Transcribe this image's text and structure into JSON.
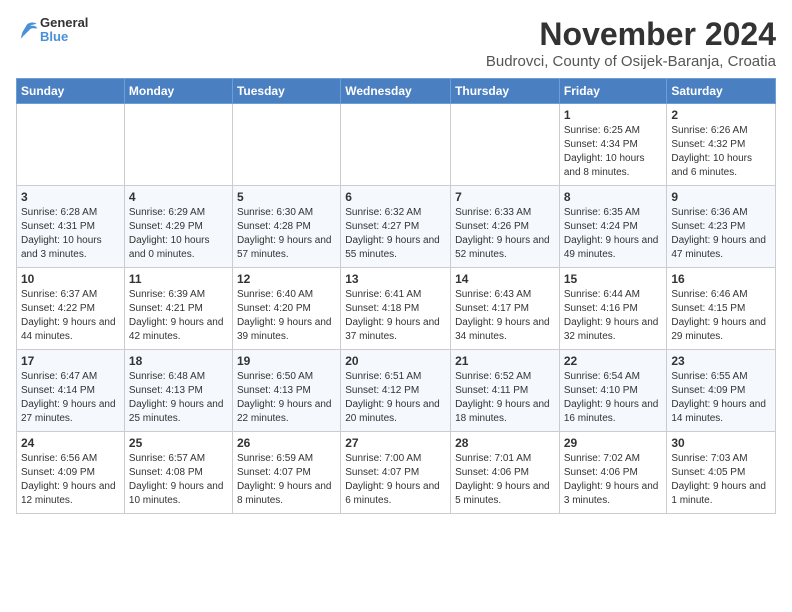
{
  "header": {
    "logo_general": "General",
    "logo_blue": "Blue",
    "month_title": "November 2024",
    "location": "Budrovci, County of Osijek-Baranja, Croatia"
  },
  "weekdays": [
    "Sunday",
    "Monday",
    "Tuesday",
    "Wednesday",
    "Thursday",
    "Friday",
    "Saturday"
  ],
  "weeks": [
    [
      {
        "day": "",
        "info": ""
      },
      {
        "day": "",
        "info": ""
      },
      {
        "day": "",
        "info": ""
      },
      {
        "day": "",
        "info": ""
      },
      {
        "day": "",
        "info": ""
      },
      {
        "day": "1",
        "info": "Sunrise: 6:25 AM\nSunset: 4:34 PM\nDaylight: 10 hours and 8 minutes."
      },
      {
        "day": "2",
        "info": "Sunrise: 6:26 AM\nSunset: 4:32 PM\nDaylight: 10 hours and 6 minutes."
      }
    ],
    [
      {
        "day": "3",
        "info": "Sunrise: 6:28 AM\nSunset: 4:31 PM\nDaylight: 10 hours and 3 minutes."
      },
      {
        "day": "4",
        "info": "Sunrise: 6:29 AM\nSunset: 4:29 PM\nDaylight: 10 hours and 0 minutes."
      },
      {
        "day": "5",
        "info": "Sunrise: 6:30 AM\nSunset: 4:28 PM\nDaylight: 9 hours and 57 minutes."
      },
      {
        "day": "6",
        "info": "Sunrise: 6:32 AM\nSunset: 4:27 PM\nDaylight: 9 hours and 55 minutes."
      },
      {
        "day": "7",
        "info": "Sunrise: 6:33 AM\nSunset: 4:26 PM\nDaylight: 9 hours and 52 minutes."
      },
      {
        "day": "8",
        "info": "Sunrise: 6:35 AM\nSunset: 4:24 PM\nDaylight: 9 hours and 49 minutes."
      },
      {
        "day": "9",
        "info": "Sunrise: 6:36 AM\nSunset: 4:23 PM\nDaylight: 9 hours and 47 minutes."
      }
    ],
    [
      {
        "day": "10",
        "info": "Sunrise: 6:37 AM\nSunset: 4:22 PM\nDaylight: 9 hours and 44 minutes."
      },
      {
        "day": "11",
        "info": "Sunrise: 6:39 AM\nSunset: 4:21 PM\nDaylight: 9 hours and 42 minutes."
      },
      {
        "day": "12",
        "info": "Sunrise: 6:40 AM\nSunset: 4:20 PM\nDaylight: 9 hours and 39 minutes."
      },
      {
        "day": "13",
        "info": "Sunrise: 6:41 AM\nSunset: 4:18 PM\nDaylight: 9 hours and 37 minutes."
      },
      {
        "day": "14",
        "info": "Sunrise: 6:43 AM\nSunset: 4:17 PM\nDaylight: 9 hours and 34 minutes."
      },
      {
        "day": "15",
        "info": "Sunrise: 6:44 AM\nSunset: 4:16 PM\nDaylight: 9 hours and 32 minutes."
      },
      {
        "day": "16",
        "info": "Sunrise: 6:46 AM\nSunset: 4:15 PM\nDaylight: 9 hours and 29 minutes."
      }
    ],
    [
      {
        "day": "17",
        "info": "Sunrise: 6:47 AM\nSunset: 4:14 PM\nDaylight: 9 hours and 27 minutes."
      },
      {
        "day": "18",
        "info": "Sunrise: 6:48 AM\nSunset: 4:13 PM\nDaylight: 9 hours and 25 minutes."
      },
      {
        "day": "19",
        "info": "Sunrise: 6:50 AM\nSunset: 4:13 PM\nDaylight: 9 hours and 22 minutes."
      },
      {
        "day": "20",
        "info": "Sunrise: 6:51 AM\nSunset: 4:12 PM\nDaylight: 9 hours and 20 minutes."
      },
      {
        "day": "21",
        "info": "Sunrise: 6:52 AM\nSunset: 4:11 PM\nDaylight: 9 hours and 18 minutes."
      },
      {
        "day": "22",
        "info": "Sunrise: 6:54 AM\nSunset: 4:10 PM\nDaylight: 9 hours and 16 minutes."
      },
      {
        "day": "23",
        "info": "Sunrise: 6:55 AM\nSunset: 4:09 PM\nDaylight: 9 hours and 14 minutes."
      }
    ],
    [
      {
        "day": "24",
        "info": "Sunrise: 6:56 AM\nSunset: 4:09 PM\nDaylight: 9 hours and 12 minutes."
      },
      {
        "day": "25",
        "info": "Sunrise: 6:57 AM\nSunset: 4:08 PM\nDaylight: 9 hours and 10 minutes."
      },
      {
        "day": "26",
        "info": "Sunrise: 6:59 AM\nSunset: 4:07 PM\nDaylight: 9 hours and 8 minutes."
      },
      {
        "day": "27",
        "info": "Sunrise: 7:00 AM\nSunset: 4:07 PM\nDaylight: 9 hours and 6 minutes."
      },
      {
        "day": "28",
        "info": "Sunrise: 7:01 AM\nSunset: 4:06 PM\nDaylight: 9 hours and 5 minutes."
      },
      {
        "day": "29",
        "info": "Sunrise: 7:02 AM\nSunset: 4:06 PM\nDaylight: 9 hours and 3 minutes."
      },
      {
        "day": "30",
        "info": "Sunrise: 7:03 AM\nSunset: 4:05 PM\nDaylight: 9 hours and 1 minute."
      }
    ]
  ]
}
